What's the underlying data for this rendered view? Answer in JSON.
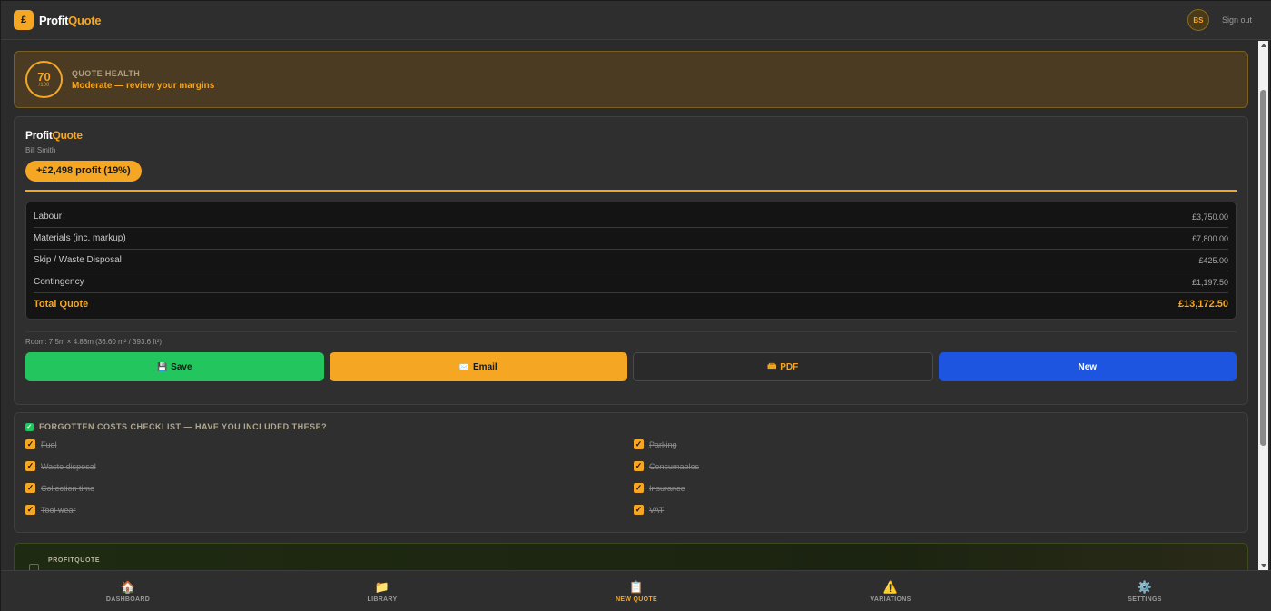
{
  "header": {
    "logo_glyph": "£",
    "brand_a": "Profit",
    "brand_b": "Quote",
    "avatar_initials": "BS",
    "signout_label": "Sign out"
  },
  "health": {
    "score": "70",
    "score_max": "/100",
    "label": "QUOTE HEALTH",
    "message": "Moderate — review your margins"
  },
  "quote": {
    "brand_a": "Profit",
    "brand_b": "Quote",
    "client": "Bill Smith",
    "profit_pill": "+£2,498 profit (19%)",
    "lines": [
      {
        "label": "Labour",
        "amount": "£3,750.00"
      },
      {
        "label": "Materials (inc. markup)",
        "amount": "£7,800.00"
      },
      {
        "label": "Skip / Waste Disposal",
        "amount": "£425.00"
      },
      {
        "label": "Contingency",
        "amount": "£1,197.50"
      }
    ],
    "total": {
      "label": "Total Quote",
      "amount": "£13,172.50"
    },
    "room": "Room: 7.5m × 4.88m (36.60 m² / 393.6 ft²)",
    "actions": {
      "save": {
        "icon": "💾",
        "label": "Save"
      },
      "email": {
        "icon": "✉️",
        "label": "Email"
      },
      "pdf": {
        "icon": "📾",
        "label": "PDF"
      },
      "new": {
        "label": "New"
      }
    }
  },
  "checklist": {
    "icon": "✓",
    "title": "FORGOTTEN COSTS CHECKLIST — HAVE YOU INCLUDED THESE?",
    "items": [
      {
        "label": "Fuel",
        "checked": true
      },
      {
        "label": "Parking",
        "checked": true
      },
      {
        "label": "Waste disposal",
        "checked": true
      },
      {
        "label": "Consumables",
        "checked": true
      },
      {
        "label": "Collection time",
        "checked": true
      },
      {
        "label": "Insurance",
        "checked": true
      },
      {
        "label": "Tool wear",
        "checked": true
      },
      {
        "label": "VAT",
        "checked": true
      }
    ]
  },
  "teaser": {
    "label": "PROFITQUOTE"
  },
  "nav": [
    {
      "icon": "🏠",
      "label": "DASHBOARD",
      "active": false
    },
    {
      "icon": "📁",
      "label": "LIBRARY",
      "active": false
    },
    {
      "icon": "📋",
      "label": "NEW QUOTE",
      "active": true
    },
    {
      "icon": "⚠️",
      "label": "VARIATIONS",
      "active": false
    },
    {
      "icon": "⚙️",
      "label": "SETTINGS",
      "active": false
    }
  ],
  "colors": {
    "accent": "#f5a623",
    "save": "#22c55e",
    "new": "#1d55e0",
    "background": "#2b2b2b"
  }
}
